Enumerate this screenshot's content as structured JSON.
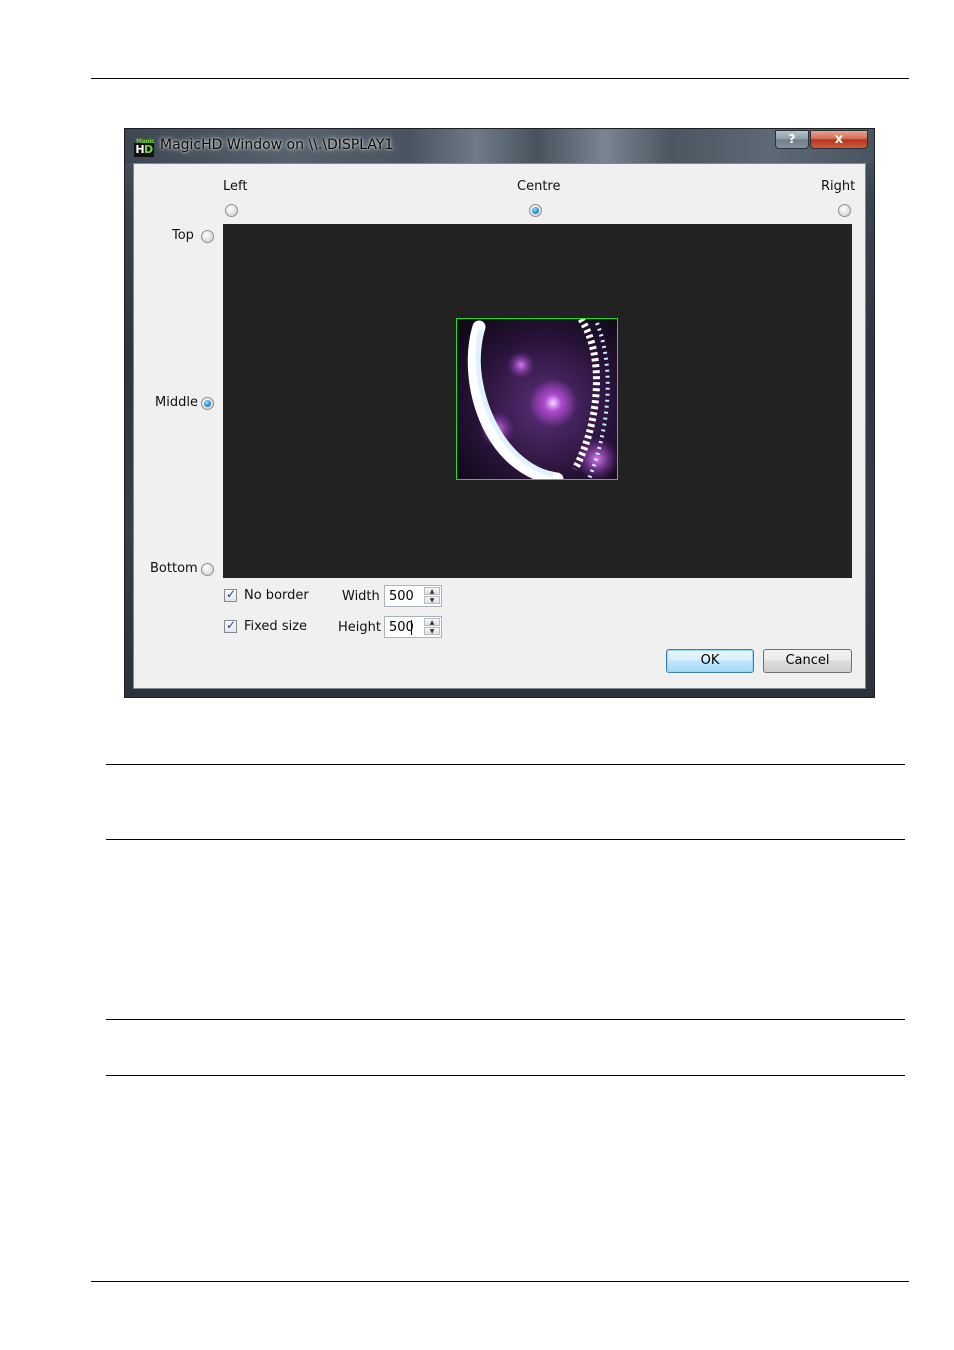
{
  "window": {
    "title": "MagicHD Window on \\\\.\\DISPLAY1",
    "icon_top_text": "Magic",
    "icon_main_text": "HD",
    "help_label": "?",
    "close_label": "x"
  },
  "dialog": {
    "horizontal": {
      "left": "Left",
      "centre": "Centre",
      "right": "Right",
      "selected": "Centre"
    },
    "vertical": {
      "top": "Top",
      "middle": "Middle",
      "bottom": "Bottom",
      "selected": "Middle"
    },
    "options": {
      "no_border": {
        "label": "No border",
        "checked": true
      },
      "fixed_size": {
        "label": "Fixed size",
        "checked": true
      }
    },
    "size": {
      "width_label": "Width",
      "width_value": "500",
      "height_label": "Height",
      "height_value": "500"
    },
    "buttons": {
      "ok": "OK",
      "cancel": "Cancel"
    }
  },
  "colors": {
    "preview_background": "#222222",
    "thumbnail_border": "#1fe01f",
    "radio_selected": "#2b8fcf"
  }
}
